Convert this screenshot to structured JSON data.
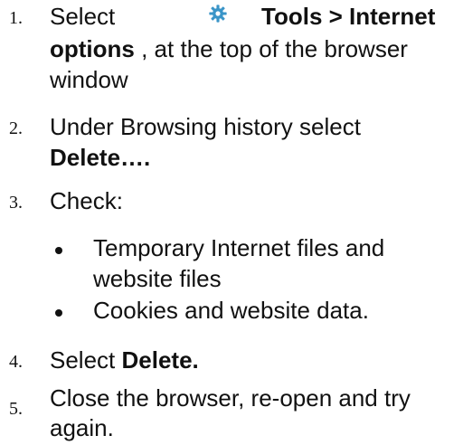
{
  "steps": [
    {
      "number": "1.",
      "select": "Select",
      "menu_path": "Tools > Internet",
      "menu_path_2": "options",
      "suffix": ", at the top of the browser",
      "line3": "window",
      "icon": "gear-icon"
    },
    {
      "number": "2.",
      "line1": "Under Browsing history select",
      "bold": "Delete…."
    },
    {
      "number": "3.",
      "line1": "Check:"
    },
    {
      "number": "4.",
      "prefix": "Select",
      "bold": "Delete."
    },
    {
      "number": "5.",
      "line1": "Close the browser, re-open and try",
      "line2": "again."
    }
  ],
  "bullets": [
    {
      "line1": "Temporary Internet files and",
      "line2": "website files"
    },
    {
      "line1": "Cookies and website data."
    }
  ],
  "colors": {
    "text": "#111111",
    "gear_icon": "#3a95c8"
  }
}
